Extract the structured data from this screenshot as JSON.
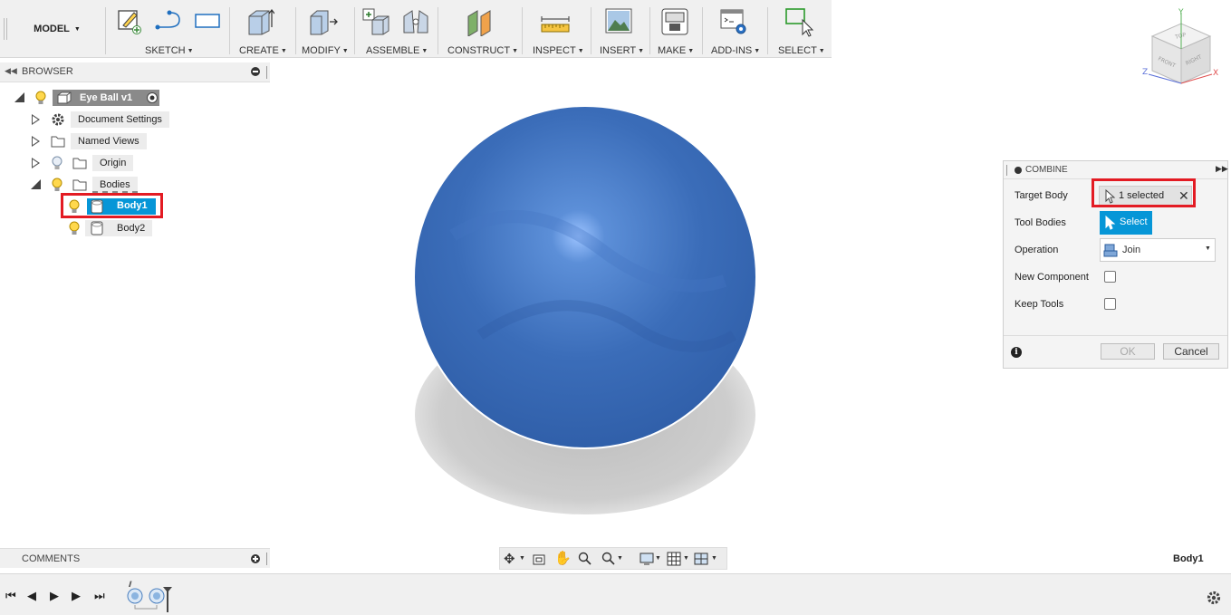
{
  "toolbar": {
    "workspace": "MODEL",
    "groups": [
      {
        "label": "SKETCH"
      },
      {
        "label": "CREATE"
      },
      {
        "label": "MODIFY"
      },
      {
        "label": "ASSEMBLE"
      },
      {
        "label": "CONSTRUCT"
      },
      {
        "label": "INSPECT"
      },
      {
        "label": "INSERT"
      },
      {
        "label": "MAKE"
      },
      {
        "label": "ADD-INS"
      },
      {
        "label": "SELECT"
      }
    ]
  },
  "browser": {
    "title": "BROWSER",
    "root": "Eye Ball v1",
    "items": [
      {
        "label": "Document Settings",
        "icon": "gear-icon"
      },
      {
        "label": "Named Views",
        "icon": "folder-icon"
      },
      {
        "label": "Origin",
        "icon": "folder-icon"
      },
      {
        "label": "Bodies",
        "icon": "folder-icon"
      }
    ],
    "bodies": [
      {
        "label": "Body1",
        "selected": true
      },
      {
        "label": "Body2",
        "selected": false
      }
    ]
  },
  "comments": {
    "title": "COMMENTS"
  },
  "viewcube": {
    "top": "TOP",
    "front": "FRONT",
    "right": "RIGHT",
    "axis_x": "X",
    "axis_y": "Y",
    "axis_z": "Z"
  },
  "combine": {
    "title": "COMBINE",
    "target_body_label": "Target Body",
    "target_body_value": "1 selected",
    "tool_bodies_label": "Tool Bodies",
    "tool_bodies_button": "Select",
    "operation_label": "Operation",
    "operation_value": "Join",
    "new_component_label": "New Component",
    "keep_tools_label": "Keep Tools",
    "ok_label": "OK",
    "cancel_label": "Cancel"
  },
  "status": {
    "selection": "Body1"
  },
  "colors": {
    "accent": "#0696d7",
    "highlight": "#e31b23",
    "sphere": "#3d6db8"
  }
}
